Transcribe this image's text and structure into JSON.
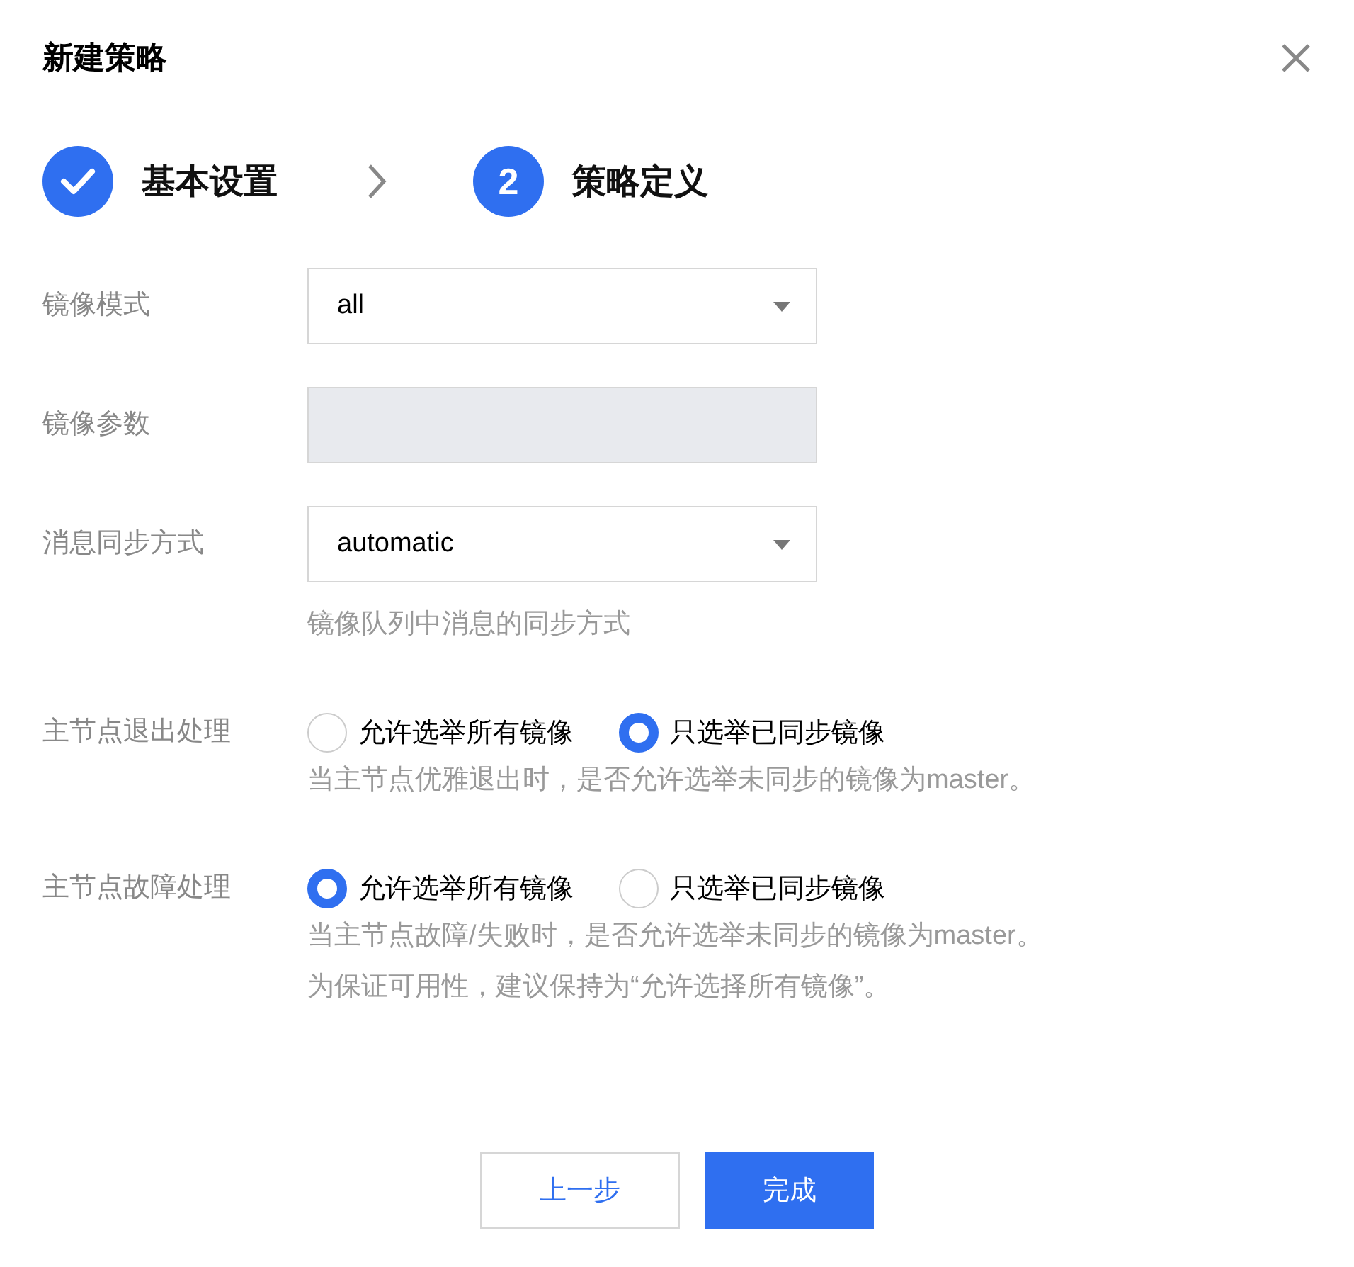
{
  "dialog": {
    "title": "新建策略"
  },
  "steps": [
    {
      "completed": true,
      "label": "基本设置"
    },
    {
      "completed": false,
      "number": "2",
      "label": "策略定义"
    }
  ],
  "fields": [
    {
      "kind": "select",
      "label": "镜像模式",
      "value": "all"
    },
    {
      "kind": "input",
      "label": "镜像参数",
      "disabled": true
    },
    {
      "kind": "select",
      "label": "消息同步方式",
      "value": "automatic",
      "hint": [
        "镜像队列中消息的同步方式"
      ]
    },
    {
      "kind": "radio",
      "label": "主节点退出处理",
      "options": [
        {
          "label": "允许选举所有镜像",
          "selected": false
        },
        {
          "label": "只选举已同步镜像",
          "selected": true
        }
      ],
      "hint": [
        "当主节点优雅退出时，是否允许选举未同步的镜像为master。"
      ]
    },
    {
      "kind": "radio",
      "label": "主节点故障处理",
      "options": [
        {
          "label": "允许选举所有镜像",
          "selected": true
        },
        {
          "label": "只选举已同步镜像",
          "selected": false
        }
      ],
      "hint": [
        "当主节点故障/失败时，是否允许选举未同步的镜像为master。",
        "为保证可用性，建议保持为“允许选择所有镜像”。"
      ]
    }
  ],
  "buttons": [
    {
      "kind": "secondary",
      "label": "上一步"
    },
    {
      "kind": "primary",
      "label": "完成"
    }
  ]
}
